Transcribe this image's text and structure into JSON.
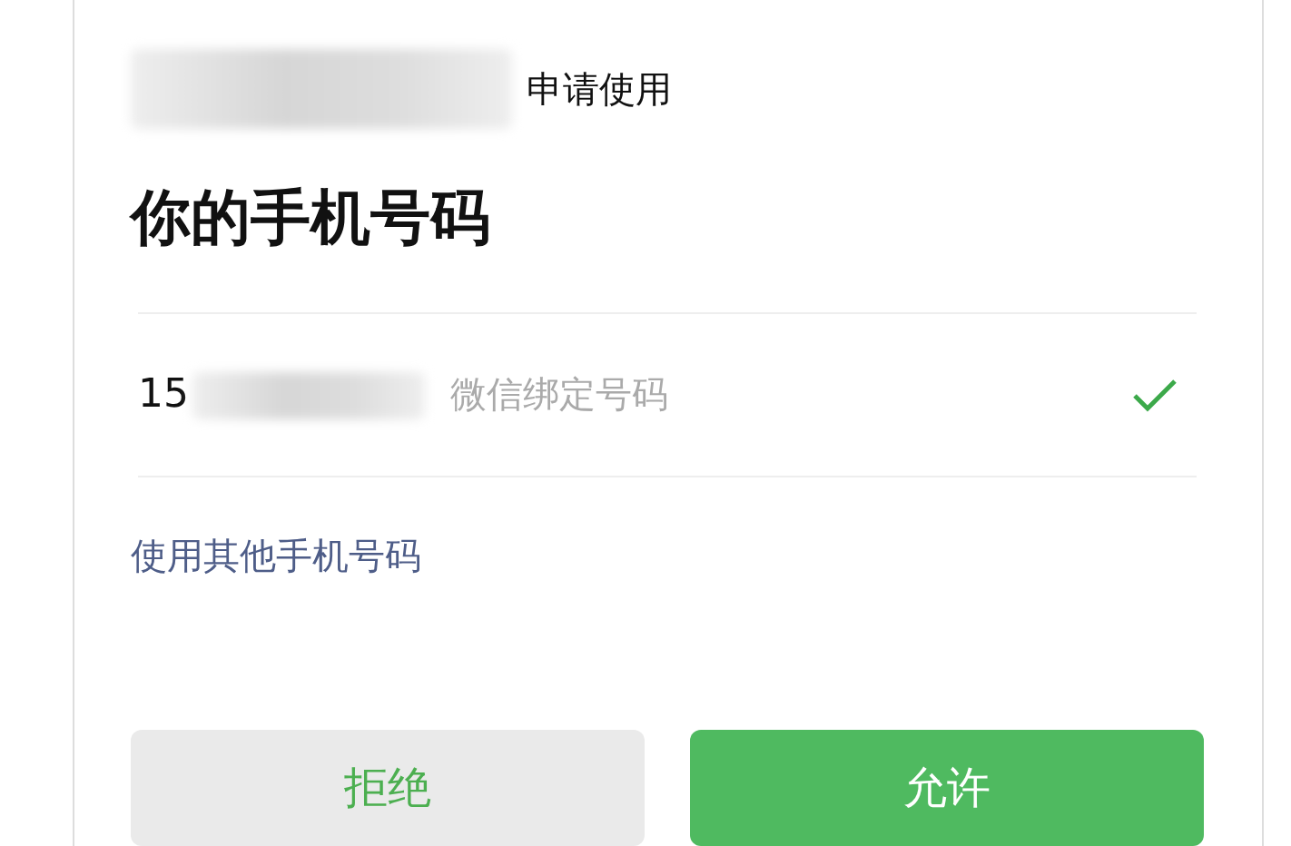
{
  "request": {
    "suffix": "申请使用"
  },
  "title": "你的手机号码",
  "phone_options": [
    {
      "number": "15",
      "note": "微信绑定号码",
      "selected": true
    }
  ],
  "other_phone_link": "使用其他手机号码",
  "buttons": [
    {
      "label": "拒绝",
      "kind": "secondary"
    },
    {
      "label": "允许",
      "kind": "primary"
    }
  ]
}
